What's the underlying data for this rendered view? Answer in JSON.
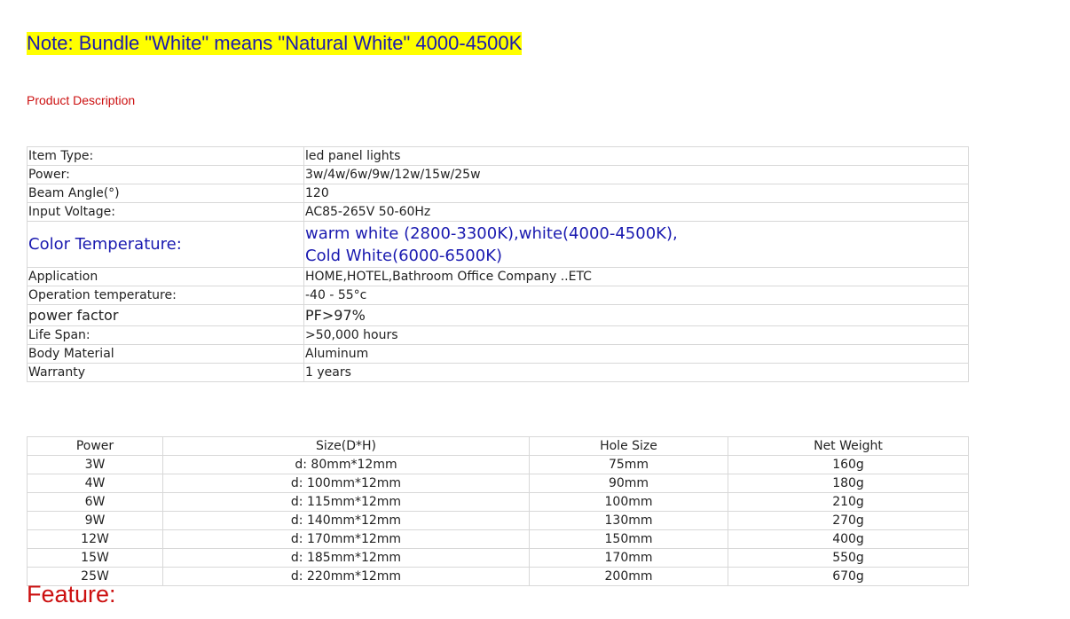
{
  "note": "Note: Bundle \"White\" means \"Natural White\" 4000-4500K",
  "description_heading": "Product Description",
  "specs": {
    "item_type": {
      "label": "Item Type:",
      "value": "led panel lights"
    },
    "power": {
      "label": "Power:",
      "value": "3w/4w/6w/9w/12w/15w/25w"
    },
    "beam_angle": {
      "label": "Beam Angle(°)",
      "value": "120"
    },
    "input_voltage": {
      "label": "Input Voltage:",
      "value": "AC85-265V  50-60Hz"
    },
    "color_temperature": {
      "label": "Color Temperature:",
      "value_line1": "warm white (2800-3300K),white(4000-4500K),",
      "value_line2": "Cold White(6000-6500K)"
    },
    "application": {
      "label": "Application",
      "value": "HOME,HOTEL,Bathroom Office  Company ..ETC"
    },
    "operation_temperature": {
      "label": "Operation temperature:",
      "value": "-40 - 55°c"
    },
    "power_factor": {
      "label": "power factor",
      "value": "PF>97%"
    },
    "life_span": {
      "label": "Life Span:",
      "value": ">50,000 hours"
    },
    "body_material": {
      "label": "Body Material",
      "value": "Aluminum"
    },
    "warranty": {
      "label": "Warranty",
      "value": "1 years"
    }
  },
  "size_table": {
    "headers": [
      "Power",
      "Size(D*H)",
      "Hole Size",
      "Net Weight"
    ],
    "rows": [
      [
        "3W",
        "d: 80mm*12mm",
        "75mm",
        "160g"
      ],
      [
        "4W",
        "d: 100mm*12mm",
        "90mm",
        "180g"
      ],
      [
        "6W",
        "d: 115mm*12mm",
        "100mm",
        "210g"
      ],
      [
        "9W",
        "d: 140mm*12mm",
        "130mm",
        "270g"
      ],
      [
        "12W",
        "d: 170mm*12mm",
        "150mm",
        "400g"
      ],
      [
        "15W",
        "d: 185mm*12mm",
        "170mm",
        "550g"
      ],
      [
        "25W",
        "d: 220mm*12mm",
        "200mm",
        "670g"
      ]
    ]
  },
  "feature_heading": "Feature:"
}
